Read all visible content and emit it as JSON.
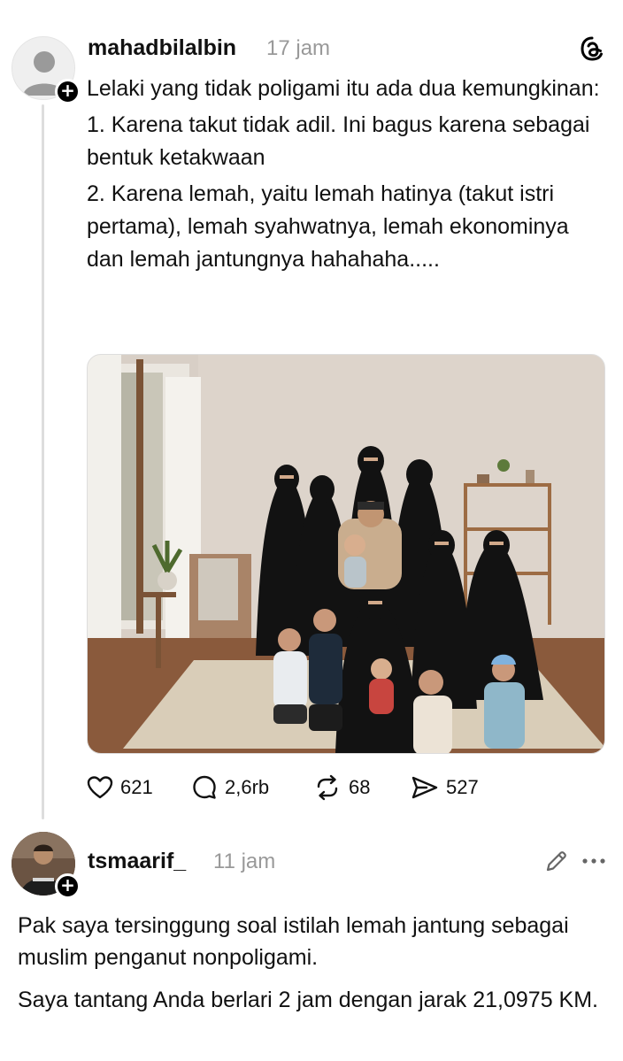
{
  "post": {
    "username": "mahadbilalbin",
    "time": "17 jam",
    "avatar_icon": "default-user-icon",
    "paragraphs": [
      "Lelaki yang tidak poligami itu ada dua kemungkinan:",
      "1. Karena takut tidak adil. Ini bagus karena sebagai bentuk ketakwaan",
      "2. Karena lemah, yaitu lemah hatinya (takut istri pertama), lemah syahwatnya, lemah ekonominya dan lemah jantungnya hahahaha....."
    ],
    "image_icon": "family-photo",
    "stats": {
      "likes": "621",
      "comments": "2,6rb",
      "reposts": "68",
      "shares": "527"
    }
  },
  "reply": {
    "username": "tsmaarif_",
    "time": "11 jam",
    "avatar_icon": "user-photo",
    "paragraphs": [
      "Pak saya tersinggung soal istilah lemah jantung sebagai muslim penganut nonpoligami.",
      "Saya tantang Anda berlari 2 jam dengan jarak 21,0975 KM."
    ]
  },
  "icons": {
    "app_logo": "threads-logo-icon",
    "edit": "pencil-icon",
    "more": "more-icon"
  }
}
